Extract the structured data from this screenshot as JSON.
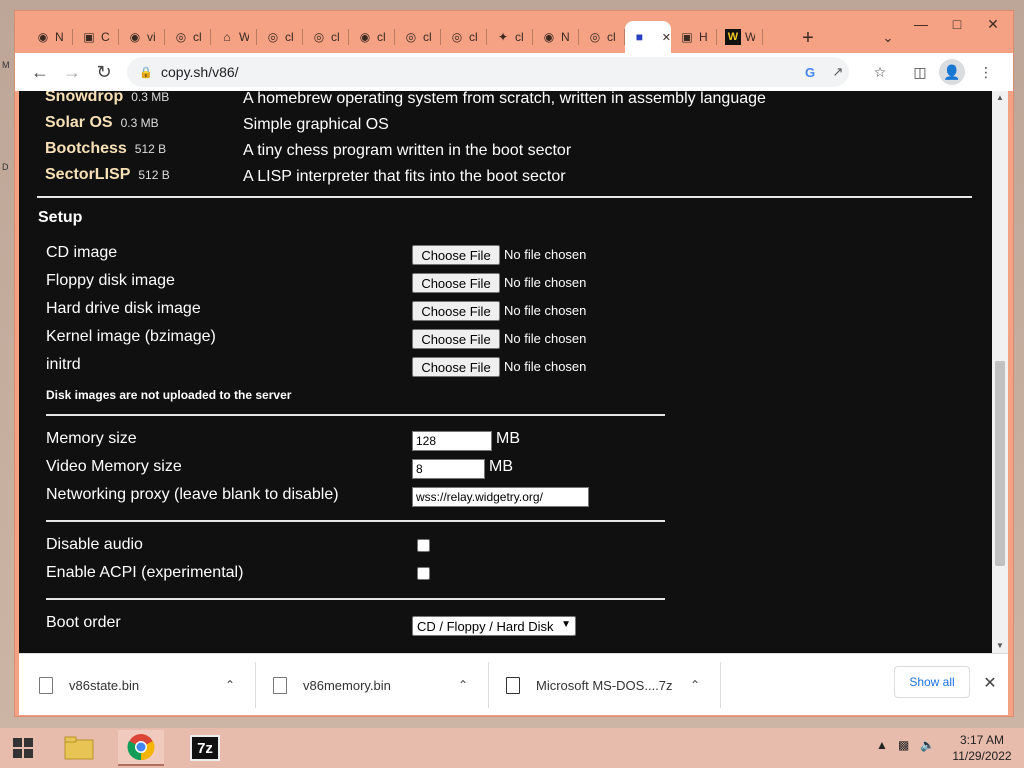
{
  "browser": {
    "tabs": [
      {
        "title": "N",
        "icon": "github-icon"
      },
      {
        "title": "C",
        "icon": "site-icon"
      },
      {
        "title": "vi",
        "icon": "github-icon"
      },
      {
        "title": "cl",
        "icon": "globe-icon"
      },
      {
        "title": "W",
        "icon": "wikipedia-icon"
      },
      {
        "title": "cl",
        "icon": "globe-icon"
      },
      {
        "title": "cl",
        "icon": "globe-icon"
      },
      {
        "title": "cl",
        "icon": "github-icon"
      },
      {
        "title": "cl",
        "icon": "globe-icon"
      },
      {
        "title": "cl",
        "icon": "globe-icon"
      },
      {
        "title": "cl",
        "icon": "puzzle-icon"
      },
      {
        "title": "N",
        "icon": "github-icon"
      },
      {
        "title": "cl",
        "icon": "globe-icon"
      },
      {
        "title": "",
        "icon": "v86-icon",
        "active": true
      },
      {
        "title": "H",
        "icon": "site-icon"
      },
      {
        "title": "W",
        "icon": "w-icon"
      }
    ],
    "new_tab": "+",
    "url": "copy.sh/v86/"
  },
  "os_list": [
    {
      "name": "Snowdrop",
      "size": "0.3 MB",
      "desc": "A homebrew operating system from scratch, written in assembly language"
    },
    {
      "name": "Solar OS",
      "size": "0.3 MB",
      "desc": "Simple graphical OS"
    },
    {
      "name": "Bootchess",
      "size": "512 B",
      "desc": "A tiny chess program written in the boot sector"
    },
    {
      "name": "SectorLISP",
      "size": "512 B",
      "desc": "A LISP interpreter that fits into the boot sector"
    }
  ],
  "setup": {
    "heading": "Setup",
    "file_rows": [
      {
        "label": "CD image",
        "button": "Choose File",
        "status": "No file chosen"
      },
      {
        "label": "Floppy disk image",
        "button": "Choose File",
        "status": "No file chosen"
      },
      {
        "label": "Hard drive disk image",
        "button": "Choose File",
        "status": "No file chosen"
      },
      {
        "label": "Kernel image (bzimage)",
        "button": "Choose File",
        "status": "No file chosen"
      },
      {
        "label": "initrd",
        "button": "Choose File",
        "status": "No file chosen"
      }
    ],
    "note": "Disk images are not uploaded to the server",
    "memory_label": "Memory size",
    "memory_value": "128",
    "memory_unit": "MB",
    "vmem_label": "Video Memory size",
    "vmem_value": "8",
    "vmem_unit": "MB",
    "proxy_label": "Networking proxy (leave blank to disable)",
    "proxy_value": "wss://relay.widgetry.org/",
    "audio_label": "Disable audio",
    "acpi_label": "Enable ACPI (experimental)",
    "boot_label": "Boot order",
    "boot_value": "CD / Floppy / Hard Disk"
  },
  "downloads": {
    "items": [
      {
        "name": "v86state.bin"
      },
      {
        "name": "v86memory.bin"
      },
      {
        "name": "Microsoft MS-DOS....7z"
      }
    ],
    "show_all": "Show all"
  },
  "taskbar": {
    "time": "3:17 AM",
    "date": "11/29/2022"
  },
  "colors": {
    "window_frame": "#f4a184",
    "page_bg": "#101010",
    "os_name": "#f7e0b6",
    "accent": "#1a73e8"
  }
}
